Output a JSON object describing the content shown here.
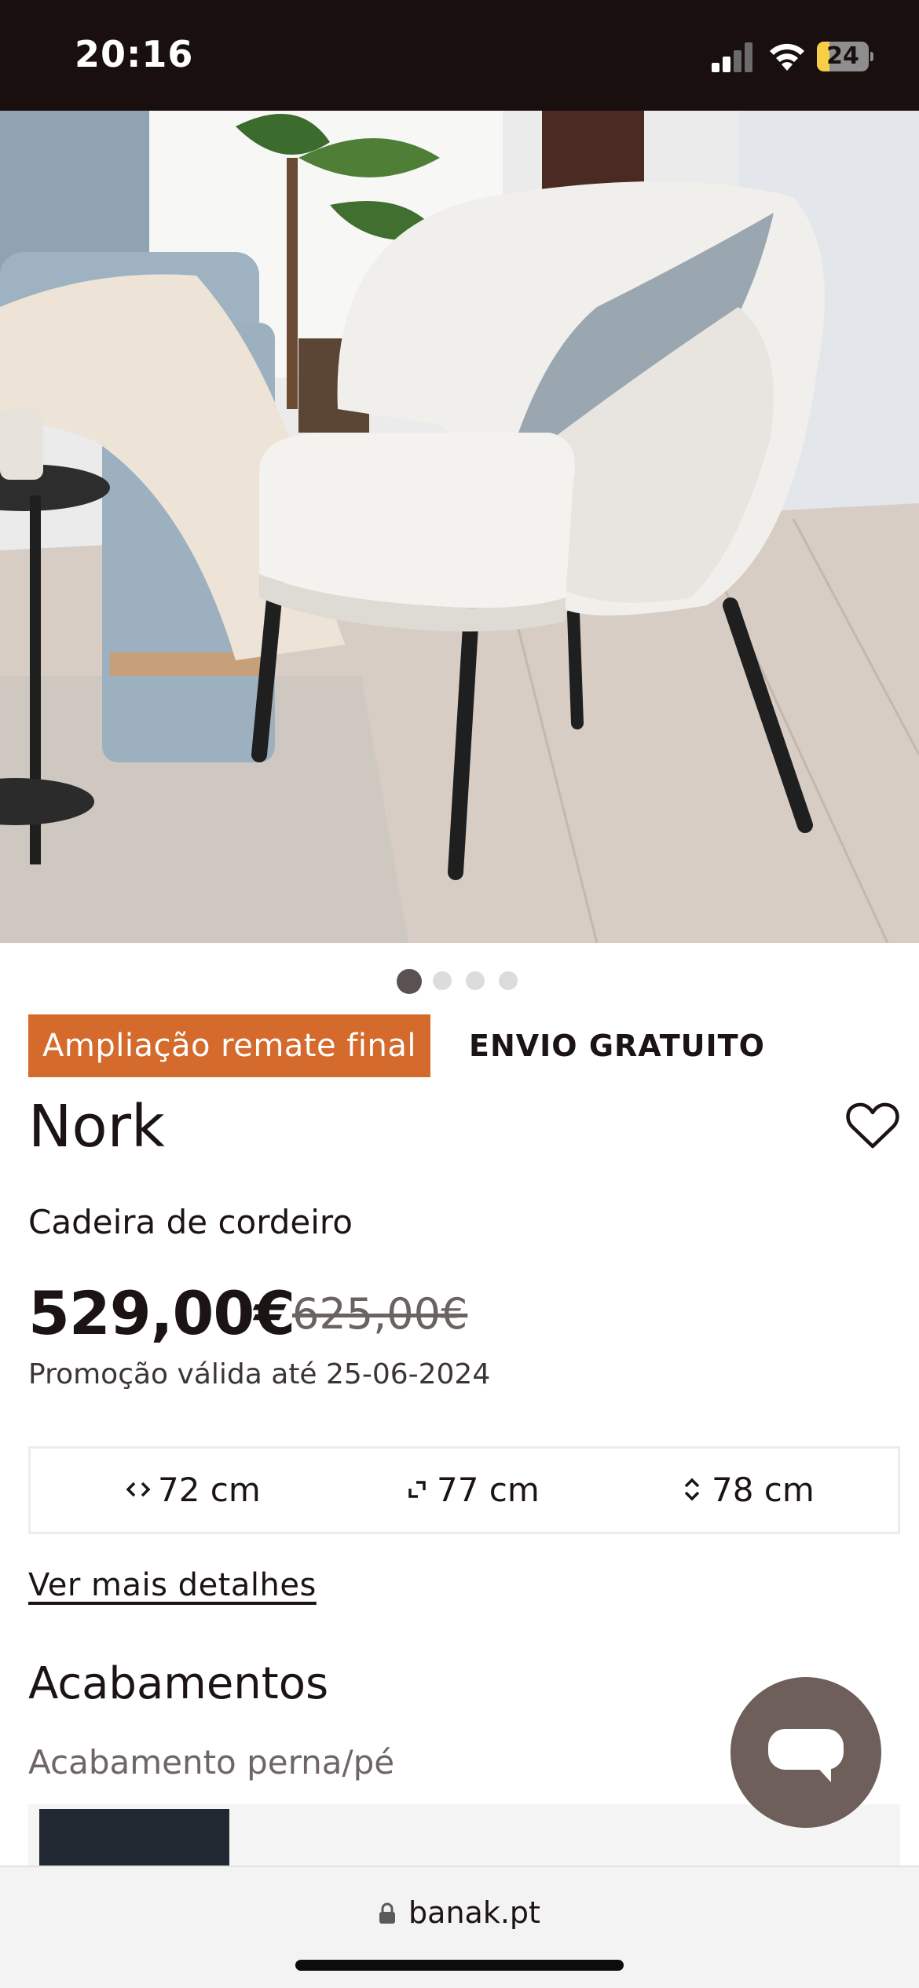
{
  "status_bar": {
    "time": "20:16",
    "battery_level": "24",
    "icons": [
      "signal-icon",
      "wifi-icon",
      "battery-icon"
    ]
  },
  "hero": {
    "image_subject": "white boucle armchair with black legs and grey cushion",
    "carousel": {
      "total": 4,
      "active_index": 0
    }
  },
  "badges": {
    "promo": "Ampliação remate final",
    "shipping": "ENVIO GRATUITO"
  },
  "product": {
    "name": "Nork",
    "subtitle": "Cadeira de cordeiro",
    "price_now": "529,00€",
    "price_old": "625,00€",
    "promo_note": "Promoção válida até 25-06-2024",
    "favorite_icon": "heart-icon"
  },
  "dimensions": [
    {
      "icon": "width-arrows-icon",
      "value": "72 cm"
    },
    {
      "icon": "depth-arrows-icon",
      "value": "77 cm"
    },
    {
      "icon": "height-arrows-icon",
      "value": "78 cm"
    }
  ],
  "details_link": "Ver mais detalhes",
  "finishes": {
    "title": "Acabamentos",
    "leg_label": "Acabamento perna/pé",
    "swatch_color": "#222831"
  },
  "chat": {
    "icon": "chat-bubble-icon"
  },
  "browser": {
    "url": "banak.pt"
  },
  "colors": {
    "status_bar_bg": "#1a0f0f",
    "promo_badge": "#d56a2d",
    "chat_button": "#6e5f5a",
    "text": "#1c1414"
  }
}
